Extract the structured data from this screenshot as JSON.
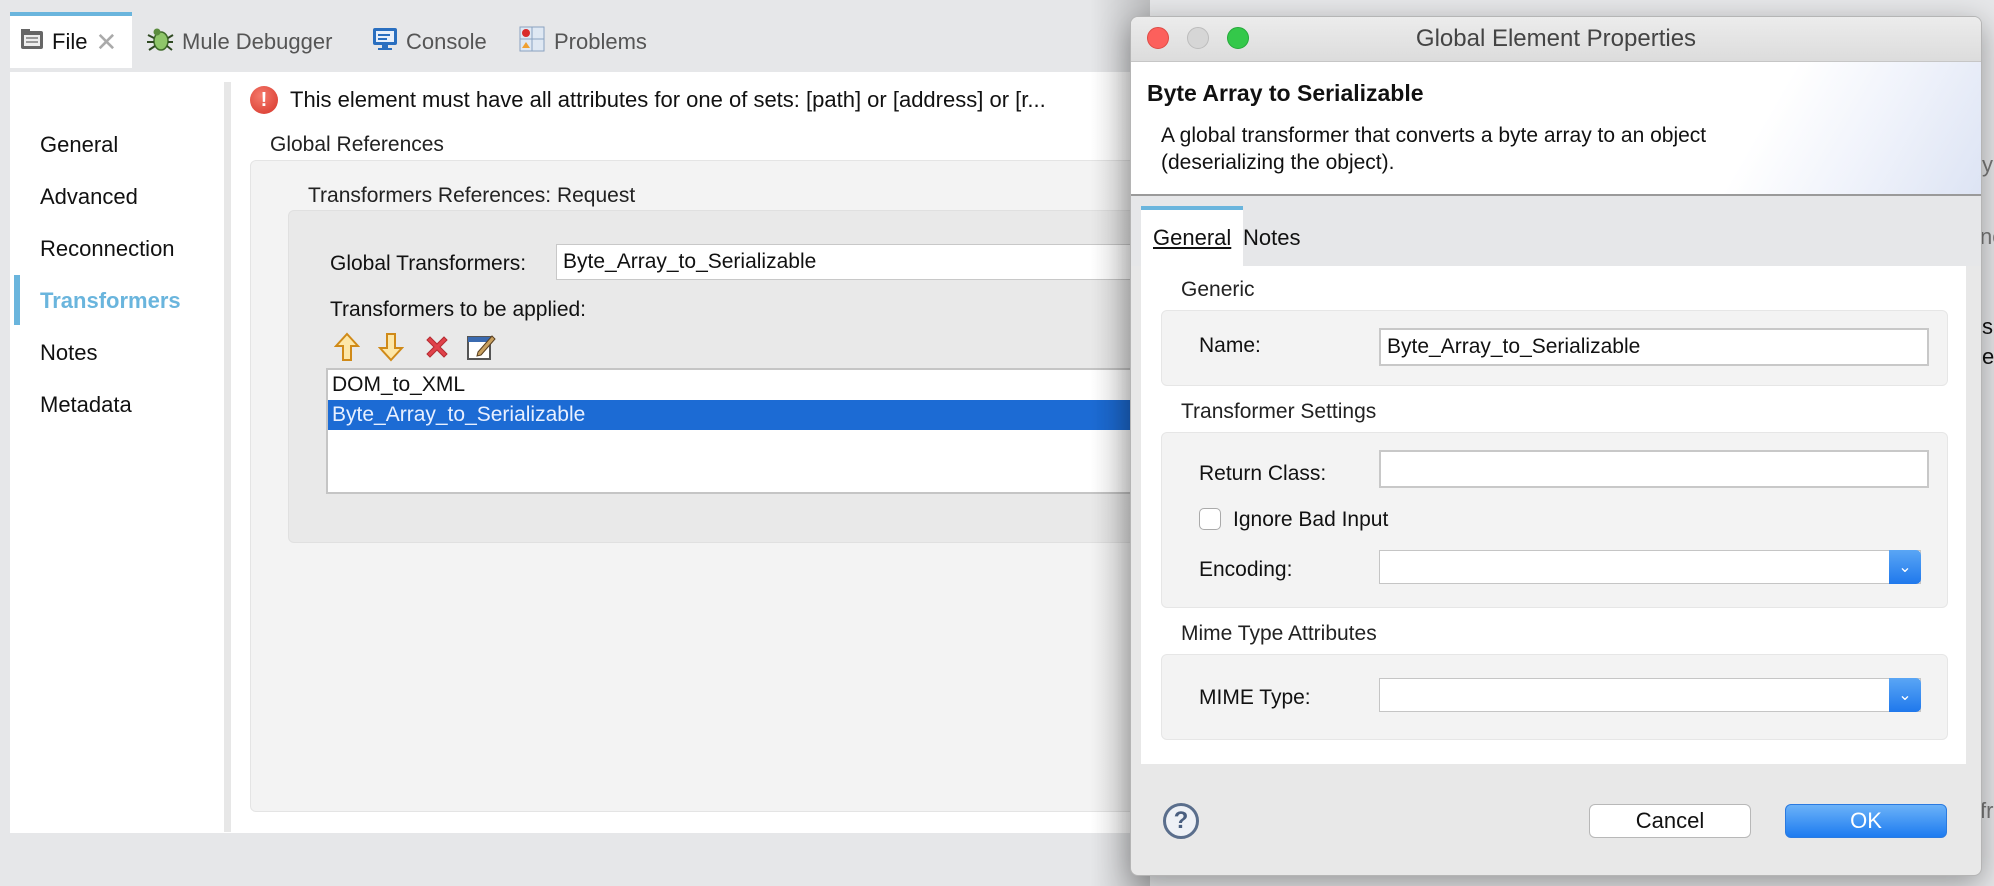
{
  "tabs": [
    {
      "label": "File",
      "icon": "file-editor-icon",
      "active": true,
      "closable": true
    },
    {
      "label": "Mule Debugger",
      "icon": "bug-icon",
      "active": false
    },
    {
      "label": "Console",
      "icon": "console-icon",
      "active": false
    },
    {
      "label": "Problems",
      "icon": "problems-icon",
      "active": false
    }
  ],
  "sidebar": {
    "items": [
      {
        "label": "General"
      },
      {
        "label": "Advanced"
      },
      {
        "label": "Reconnection"
      },
      {
        "label": "Transformers",
        "active": true
      },
      {
        "label": "Notes"
      },
      {
        "label": "Metadata"
      }
    ]
  },
  "editor": {
    "error_message": "This element must have all attributes for one of sets: [path] or [address] or [r...",
    "global_references_title": "Global References",
    "transformers_section_title": "Transformers References: Request",
    "global_transformers_label": "Global Transformers:",
    "global_transformers_value": "Byte_Array_to_Serializable",
    "transformers_applied_label": "Transformers to be applied:",
    "toolbar": {
      "move_up": "arrow-up-icon",
      "move_down": "arrow-down-icon",
      "delete": "delete-icon",
      "edit": "edit-icon"
    },
    "transformers_list": [
      {
        "label": "DOM_to_XML",
        "selected": false
      },
      {
        "label": "Byte_Array_to_Serializable",
        "selected": true
      }
    ]
  },
  "dialog": {
    "window_title": "Global Element Properties",
    "header_title": "Byte Array to Serializable",
    "header_desc_line1": "A global transformer that converts a byte array to an object",
    "header_desc_line2": "(deserializing the object).",
    "tabs": [
      {
        "label": "General",
        "active": true
      },
      {
        "label": "Notes",
        "active": false
      }
    ],
    "generic": {
      "title": "Generic",
      "name_label": "Name:",
      "name_value": "Byte_Array_to_Serializable"
    },
    "transformer_settings": {
      "title": "Transformer Settings",
      "return_class_label": "Return Class:",
      "return_class_value": "",
      "ignore_bad_input_label": "Ignore Bad Input",
      "ignore_bad_input_checked": false,
      "encoding_label": "Encoding:",
      "encoding_value": ""
    },
    "mime_type": {
      "title": "Mime Type Attributes",
      "mime_type_label": "MIME Type:",
      "mime_type_value": ""
    },
    "buttons": {
      "cancel": "Cancel",
      "ok": "OK"
    },
    "colors": {
      "accent": "#6ab5dd",
      "selection": "#1c6bd4",
      "ok_button": "#1d7bf0"
    }
  },
  "background_peek": {
    "fragments": [
      "y",
      "no",
      "s",
      "e",
      "fr"
    ]
  }
}
